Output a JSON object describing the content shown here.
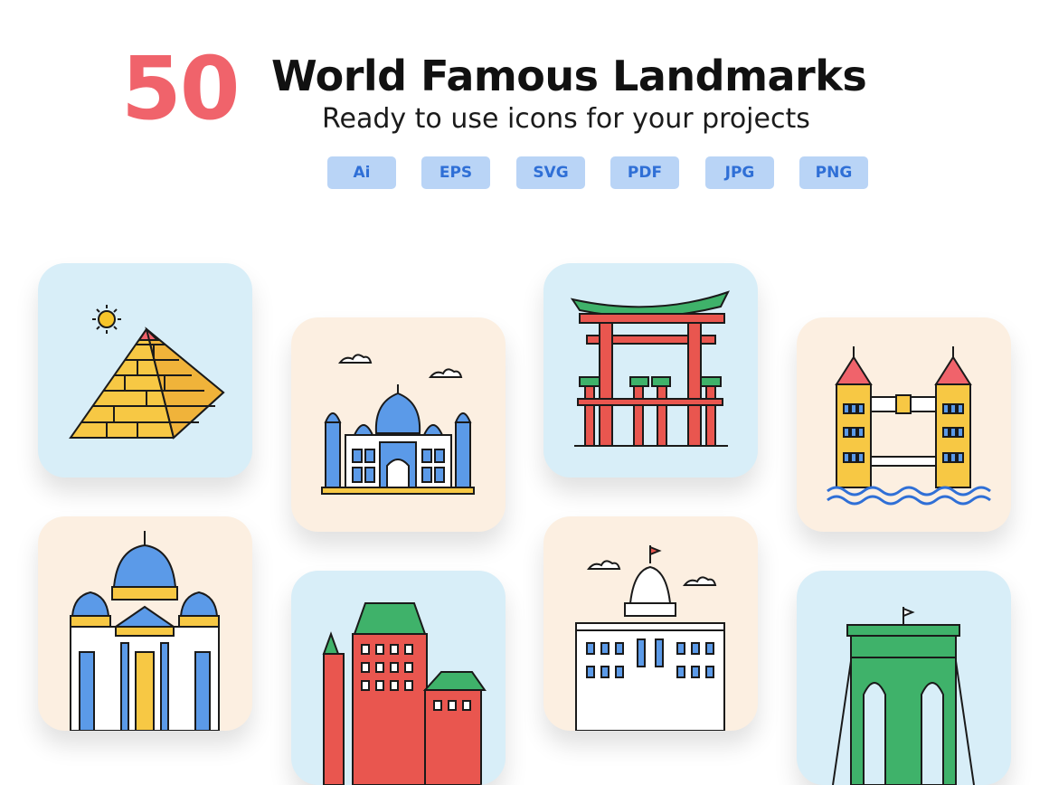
{
  "header": {
    "count": "50",
    "title": "World Famous Landmarks",
    "subtitle": "Ready to use icons for your projects"
  },
  "formats": [
    "Ai",
    "EPS",
    "SVG",
    "PDF",
    "JPG",
    "PNG"
  ],
  "colors": {
    "accent_red": "#f0636b",
    "badge_bg": "#b9d4f6",
    "badge_text": "#2f6fd6",
    "card_blue": "#d8eef8",
    "card_cream": "#fcefe1"
  },
  "cards": [
    {
      "icon": "pyramid-icon",
      "bg": "blue"
    },
    {
      "icon": "taj-mahal-icon",
      "bg": "cream"
    },
    {
      "icon": "torii-gate-icon",
      "bg": "blue"
    },
    {
      "icon": "tower-bridge-icon",
      "bg": "cream"
    },
    {
      "icon": "berlin-cathedral-icon",
      "bg": "cream"
    },
    {
      "icon": "chateau-frontenac-icon",
      "bg": "blue"
    },
    {
      "icon": "capitol-building-icon",
      "bg": "cream"
    },
    {
      "icon": "brooklyn-bridge-icon",
      "bg": "blue"
    }
  ]
}
